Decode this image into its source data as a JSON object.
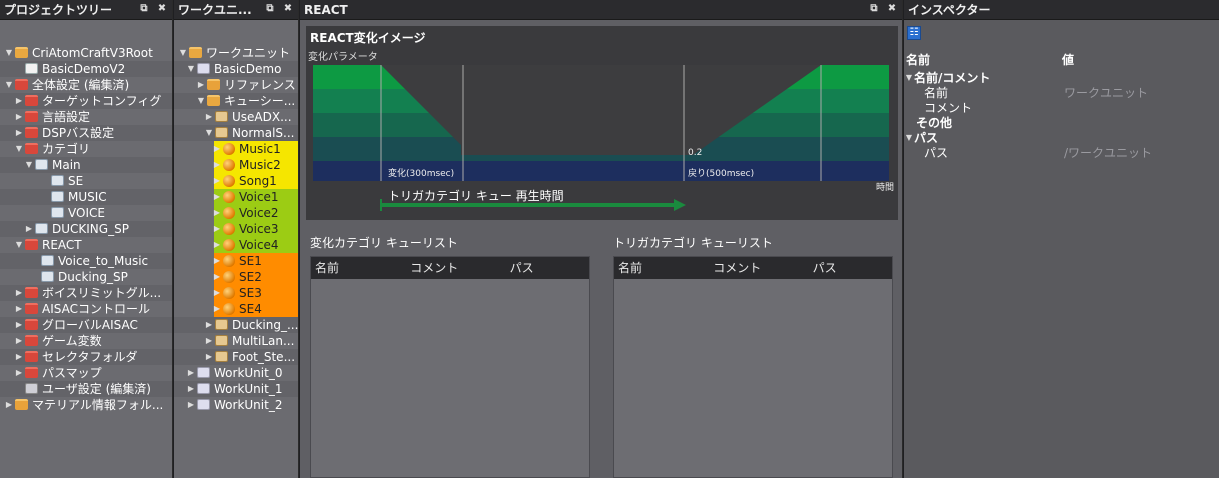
{
  "project_tree": {
    "title": "プロジェクトツリー",
    "items": [
      "CriAtomCraftV3Root",
      "BasicDemoV2",
      "全体設定 (編集済)",
      "ターゲットコンフィグ",
      "言語設定",
      "DSPバス設定",
      "カテゴリ",
      "Main",
      "SE",
      "MUSIC",
      "VOICE",
      "DUCKING_SP",
      "REACT",
      "Voice_to_Music",
      "Ducking_SP",
      "ボイスリミットグル...",
      "AISACコントロール",
      "グローバルAISAC",
      "ゲーム変数",
      "セレクタフォルダ",
      "パスマップ",
      "ユーザ設定 (編集済)",
      "マテリアル情報フォル..."
    ]
  },
  "work_unit": {
    "title": "ワークユニ...",
    "items": [
      "ワークユニット",
      "BasicDemo",
      "リファレンス",
      "キューシー...",
      "UseADX...",
      "NormalS...",
      "Music1",
      "Music2",
      "Song1",
      "Voice1",
      "Voice2",
      "Voice3",
      "Voice4",
      "SE1",
      "SE2",
      "SE3",
      "SE4",
      "Ducking_...",
      "MultiLan...",
      "Foot_Ste...",
      "WorkUnit_0",
      "WorkUnit_1",
      "WorkUnit_2"
    ]
  },
  "colors": {
    "music": "#f5e600",
    "voice": "#9ccc14",
    "se": "#ff8c00",
    "graph_green": "#0a9a40",
    "graph_dark": "#1a2d5a"
  },
  "react": {
    "title": "REACT",
    "image_title": "REACT変化イメージ",
    "param_label": "変化パラメータ",
    "change_label": "変化(300msec)",
    "return_label": "戻り(500msec)",
    "value_label": "0.2",
    "time_label": "時間",
    "arrow_label": "トリガカテゴリ キュー 再生時間",
    "change_list": {
      "title": "変化カテゴリ キューリスト",
      "cols": [
        "名前",
        "コメント",
        "パス"
      ]
    },
    "trigger_list": {
      "title": "トリガカテゴリ キューリスト",
      "cols": [
        "名前",
        "コメント",
        "パス"
      ]
    }
  },
  "inspector": {
    "title": "インスペクター",
    "col_name": "名前",
    "col_value": "値",
    "sec1": "名前/コメント",
    "name_label": "名前",
    "name_value": "ワークユニット",
    "comment_label": "コメント",
    "other": "その他",
    "sec2": "パス",
    "path_label": "パス",
    "path_value": "/ワークユニット"
  }
}
